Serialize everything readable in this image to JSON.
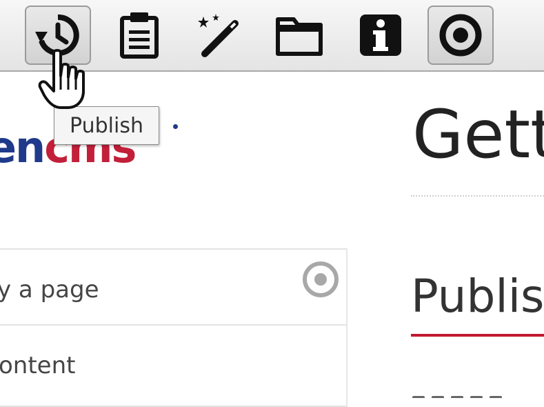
{
  "toolbar": {
    "buttons": [
      {
        "icon": "history-icon",
        "pressed": true
      },
      {
        "icon": "clipboard-icon",
        "pressed": false
      },
      {
        "icon": "magic-wand-icon",
        "pressed": false
      },
      {
        "icon": "folder-icon",
        "pressed": false
      },
      {
        "icon": "info-icon",
        "pressed": false
      },
      {
        "icon": "target-icon",
        "pressed": true
      }
    ]
  },
  "tooltip": {
    "text": "Publish"
  },
  "logo": {
    "part1": "en",
    "part2": "cms"
  },
  "left_panel": {
    "row1_text": "y a page",
    "row2_text": "ontent"
  },
  "main": {
    "title_partial": "Gett",
    "section_heading_partial": "Publis"
  },
  "colors": {
    "logo_blue": "#1f3a8a",
    "logo_red": "#c21f3a",
    "accent_red_rule": "#c2182f",
    "toolbar_border": "#a9a9a9"
  }
}
